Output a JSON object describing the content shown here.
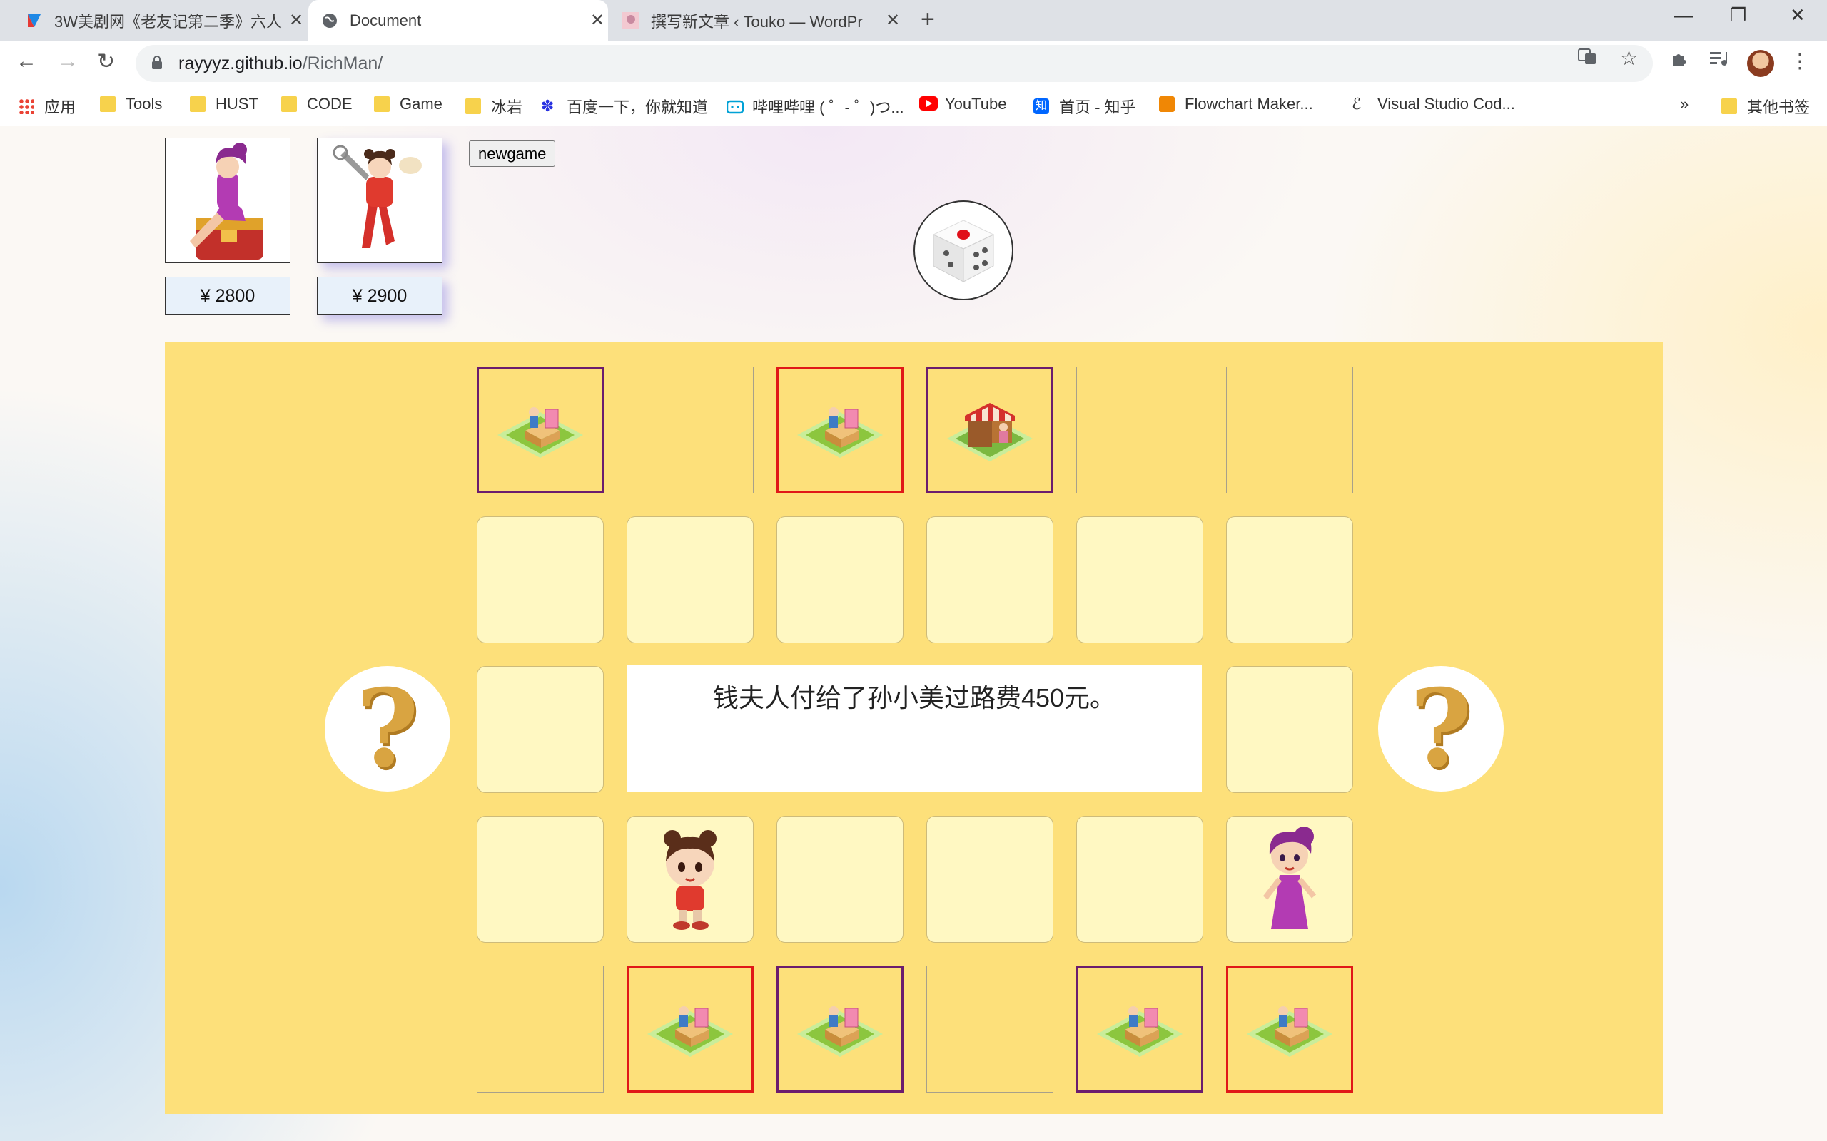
{
  "browser": {
    "tabs": [
      {
        "title": "3W美剧网《老友记第二季》六人",
        "favicon": "3w-favicon",
        "active": false
      },
      {
        "title": "Document",
        "favicon": "globe-icon",
        "active": true
      },
      {
        "title": "撰写新文章 ‹ Touko — WordPr",
        "favicon": "wordpress-avatar",
        "active": false
      }
    ],
    "url_host": "rayyyz.github.io",
    "url_path": "/RichMan/",
    "bookmarks": [
      {
        "label": "应用",
        "icon": "apps-grid-icon"
      },
      {
        "label": "Tools",
        "icon": "folder-icon"
      },
      {
        "label": "HUST",
        "icon": "folder-icon"
      },
      {
        "label": "CODE",
        "icon": "folder-icon"
      },
      {
        "label": "Game",
        "icon": "folder-icon"
      },
      {
        "label": "冰岩",
        "icon": "folder-icon"
      },
      {
        "label": "百度一下，你就知道",
        "icon": "baidu-paw-icon"
      },
      {
        "label": "哔哩哔哩 ( ゜- ゜)つ...",
        "icon": "bilibili-icon"
      },
      {
        "label": "YouTube",
        "icon": "youtube-icon"
      },
      {
        "label": "首页 - 知乎",
        "icon": "zhihu-icon"
      },
      {
        "label": "Flowchart Maker...",
        "icon": "drawio-icon"
      },
      {
        "label": "Visual Studio Cod...",
        "icon": "vscode-icon"
      }
    ],
    "more_bookmarks": "»",
    "other_bookmarks": "其他书签"
  },
  "game": {
    "newgame_label": "newgame",
    "players": [
      {
        "name": "钱夫人",
        "money": "¥ 2800",
        "color": "#6b1c6e",
        "active": false
      },
      {
        "name": "孙小美",
        "money": "¥ 2900",
        "color": "#e01818",
        "active": true
      }
    ],
    "dice_face": 1,
    "message": "钱夫人付给了孙小美过路费450元。"
  }
}
